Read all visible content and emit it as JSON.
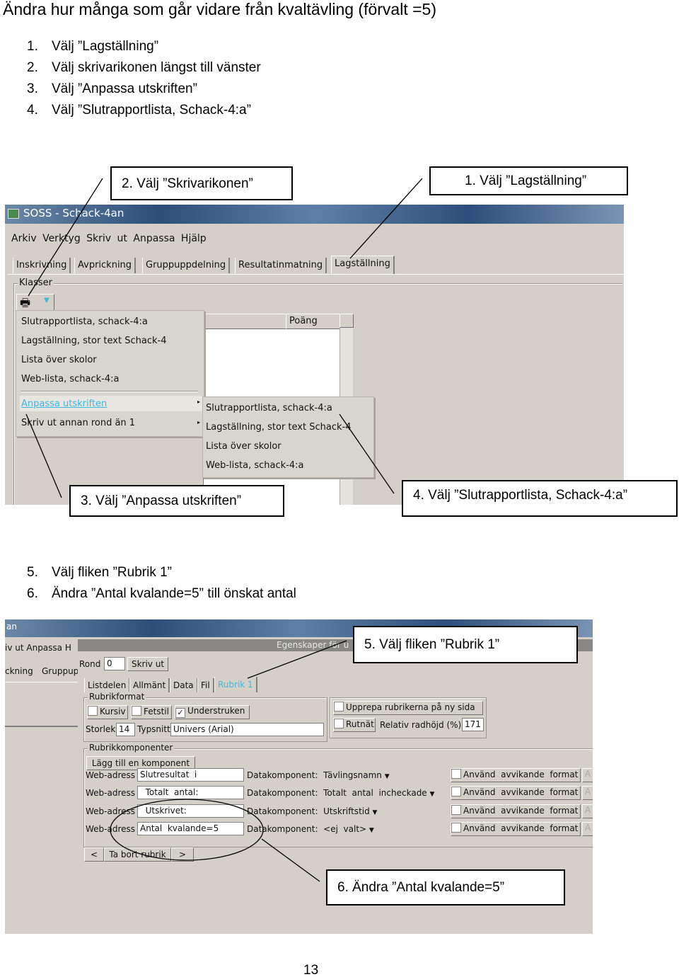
{
  "heading": "Ändra hur många som går vidare från kvaltävling (förvalt =5)",
  "steps_a": [
    {
      "n": "1.",
      "text": "Välj ”Lagställning”"
    },
    {
      "n": "2.",
      "text": "Välj skrivarikonen längst till vänster"
    },
    {
      "n": "3.",
      "text": "Välj ”Anpassa utskriften”"
    },
    {
      "n": "4.",
      "text": "Välj ”Slutrapportlista, Schack-4:a”"
    }
  ],
  "steps_b": [
    {
      "n": "5.",
      "text": "Välj fliken  ”Rubrik 1”"
    },
    {
      "n": "6.",
      "text": "Ändra ”Antal kvalande=5” till önskat antal"
    }
  ],
  "callouts": {
    "c1": "1.   Välj ”Lagställning”",
    "c2": "2. Välj ”Skrivarikonen”",
    "c3": "3. Välj ”Anpassa utskriften”",
    "c4": "4. Välj ”Slutrapportlista, Schack-4:a”",
    "c5": "5. Välj fliken ”Rubrik 1”",
    "c6": "6.  Ändra ”Antal kvalande=5”"
  },
  "shot1": {
    "title": "SOSS - Schack-4an",
    "menu": [
      "Arkiv",
      "Verktyg",
      "Skriv ut",
      "Anpassa",
      "Hjälp"
    ],
    "tabs": [
      "Inskrivning",
      "Avprickning",
      "Gruppuppdelning",
      "Resultatinmatning",
      "Lagställning"
    ],
    "group": "Klasser",
    "printer_icon": "printer-icon",
    "column": "Poäng",
    "dropdown": [
      "Slutrapportlista, schack-4:a",
      "Lagställning, stor text Schack-4",
      "Lista över skolor",
      "Web-lista, schack-4:a"
    ],
    "dropdown2": [
      "Anpassa utskriften",
      "Skriv ut annan rond än 1"
    ],
    "submenu": [
      "Slutrapportlista, schack-4:a",
      "Lagställning, stor text Schack-4",
      "Lista över skolor",
      "Web-lista, schack-4:a"
    ],
    "accent": "#3fb8e0"
  },
  "shot2": {
    "title": "an",
    "menu_partial": "iv  ut  Anpassa  H",
    "tabs_partial": [
      "ckning",
      "Gruppup"
    ],
    "dialog_title": "Egenskaper  för  u",
    "rond_label": "Rond",
    "rond_value": "0",
    "print_button": "Skriv  ut",
    "tabs": [
      "Listdelen",
      "Allmänt",
      "Data",
      "Fil",
      "Rubrik  1"
    ],
    "rubrikformat": "Rubrikformat",
    "kursiv": "Kursiv",
    "fetstil": "Fetstil",
    "understruken": "Understruken",
    "storlek_label": "Storlek",
    "storlek_value": "14",
    "typsnitt_label": "Typsnitt",
    "typsnitt_value": "Univers  (Arial)",
    "upprepa": "Upprepa  rubrikerna  på  ny  sida",
    "rutnat": "Rutnät",
    "radhojd_label": "Relativ  radhöjd  (%)",
    "radhojd_value": "171",
    "komponenter": "Rubrikkomponenter",
    "add_button": "Lägg  till  en  komponent",
    "rows": [
      {
        "label": "Web-adress",
        "value": "Slutresultat  i",
        "dk": "Datakomponent:  Tävlingsnamn",
        "fmt": "Använd  avvikande  format"
      },
      {
        "label": "Web-adress",
        "value": "  Totalt  antal:",
        "dk": "Datakomponent:  Totalt  antal  incheckade",
        "fmt": "Använd  avvikande  format"
      },
      {
        "label": "Web-adress",
        "value": "  Utskrivet:",
        "dk": "Datakomponent:  Utskriftstid",
        "fmt": "Använd  avvikande  format"
      },
      {
        "label": "Web-adress",
        "value": "Antal  kvalande=5",
        "dk": "Datakomponent:  <ej  valt>",
        "fmt": "Använd  avvikande  format"
      }
    ],
    "prev": "<",
    "remove": "Ta  bort  rubrik",
    "next": ">",
    "accent": "#3fb8e0"
  },
  "page_number": "13"
}
